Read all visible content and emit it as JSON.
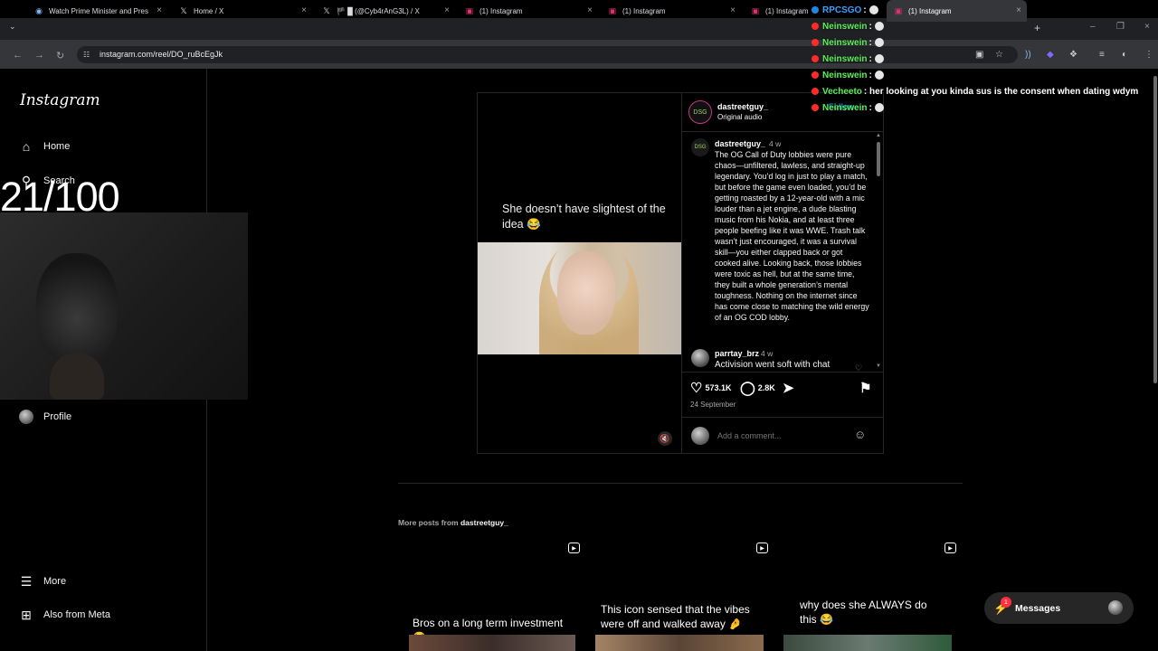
{
  "browser": {
    "tabs": [
      {
        "title": "Watch Prime Minister and Pres",
        "icon": "globe-icon"
      },
      {
        "title": "Home / X",
        "icon": "x-logo-icon"
      },
      {
        "title": "🏴 █ (@Cyb4rAnG3L) / X",
        "icon": "x-logo-icon"
      },
      {
        "title": "(1) Instagram",
        "icon": "instagram-icon"
      },
      {
        "title": "(1) Instagram",
        "icon": "instagram-icon"
      },
      {
        "title": "(1) Instagram",
        "icon": "instagram-icon"
      },
      {
        "title": "(1) Instagram",
        "icon": "instagram-icon"
      }
    ],
    "url": "instagram.com/reel/DO_ruBcEgJk"
  },
  "sidebar": {
    "logo": "Instagram",
    "items": [
      {
        "label": "Home",
        "icon": "home-icon"
      },
      {
        "label": "Search",
        "icon": "search-icon"
      },
      {
        "label": "Profile",
        "icon": "avatar"
      },
      {
        "label": "More",
        "icon": "hamburger-icon"
      },
      {
        "label": "Also from Meta",
        "icon": "meta-grid-icon"
      }
    ]
  },
  "overlay": {
    "counter": "21/100"
  },
  "post": {
    "video_caption": "She doesn’t have slightest of the idea 😂",
    "author": "dastreetguy_",
    "audio": "Original audio",
    "follow_label": "Follow",
    "caption": {
      "user": "dastreetguy_",
      "time": "4 w",
      "text": "The OG Call of Duty lobbies were pure chaos—unfiltered, lawless, and straight-up legendary. You’d log in just to play a match, but before the game even loaded, you’d be getting roasted by a 12-year-old with a mic louder than a jet engine, a dude blasting music from his Nokia, and at least three people beefing like it was WWE. Trash talk wasn’t just encouraged, it was a survival skill—you either clapped back or got cooked alive. Looking back, those lobbies were toxic as hell, but at the same time, they built a whole generation’s mental toughness. Nothing on the internet since has come close to matching the wild energy of an OG COD lobby."
    },
    "first_comment": {
      "user": "parrtay_brz",
      "time": "4 w",
      "text": "Activision went soft with chat"
    },
    "likes": "573.1K",
    "comments": "2.8K",
    "date": "24 September",
    "add_comment_placeholder": "Add a comment..."
  },
  "more_posts": {
    "prefix": "More posts from",
    "user": "dastreetguy_",
    "items": [
      {
        "caption": "Bros on a long term investment 😂"
      },
      {
        "caption": "This icon sensed that the vibes were off and walked away 🤌"
      },
      {
        "caption": "why does she ALWAYS do this 😂"
      }
    ]
  },
  "messages": {
    "label": "Messages",
    "badge": "1"
  },
  "chat": [
    {
      "name": "RPCSGO",
      "name_color": "#3aa0ff",
      "msg": ":",
      "platform": "kick"
    },
    {
      "name": "Neinswein",
      "name_color": "#5cf05c",
      "msg": ":",
      "platform": "youtube"
    },
    {
      "name": "Neinswein",
      "name_color": "#5cf05c",
      "msg": ":",
      "platform": "youtube"
    },
    {
      "name": "Neinswein",
      "name_color": "#5cf05c",
      "msg": ":",
      "platform": "youtube"
    },
    {
      "name": "Neinswein",
      "name_color": "#5cf05c",
      "msg": ":",
      "platform": "youtube"
    },
    {
      "name": "Vecheeto",
      "name_color": "#5cf05c",
      "msg": ": her looking at you kinda sus is the consent when dating wdym",
      "platform": "youtube"
    },
    {
      "name": "Neinswein",
      "name_color": "#5cf05c",
      "msg": ":",
      "platform": "youtube"
    }
  ]
}
